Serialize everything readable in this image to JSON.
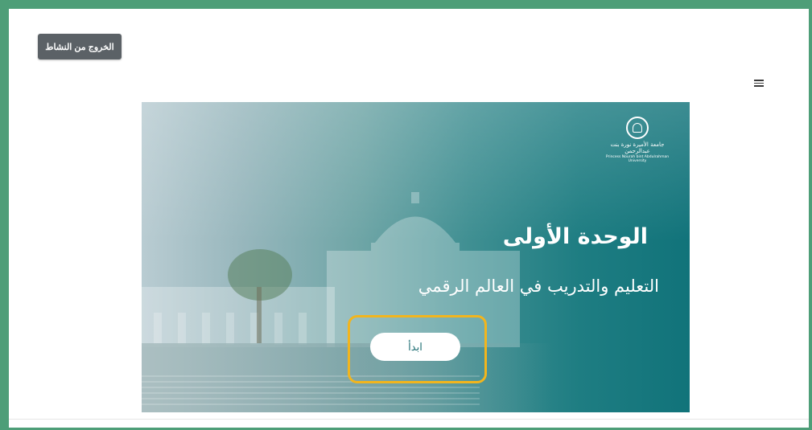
{
  "header": {
    "exit_label": "الخروج من النشاط",
    "menu_icon": "hamburger-menu-icon"
  },
  "banner": {
    "logo": {
      "icon": "university-emblem-icon",
      "name_ar": "جامعة الأميرة نورة بنت عبدالرحمن",
      "name_en": "Princess Nourah bint Abdulrahman University"
    },
    "title": "الوحدة الأولى",
    "subtitle": "التعليم والتدريب في العالم الرقمي",
    "start_label": "ابدأ"
  },
  "colors": {
    "frame_border": "#4e9e78",
    "highlight": "#f2b51d",
    "banner_dark": "#11737a",
    "exit_button": "#5b6166"
  }
}
